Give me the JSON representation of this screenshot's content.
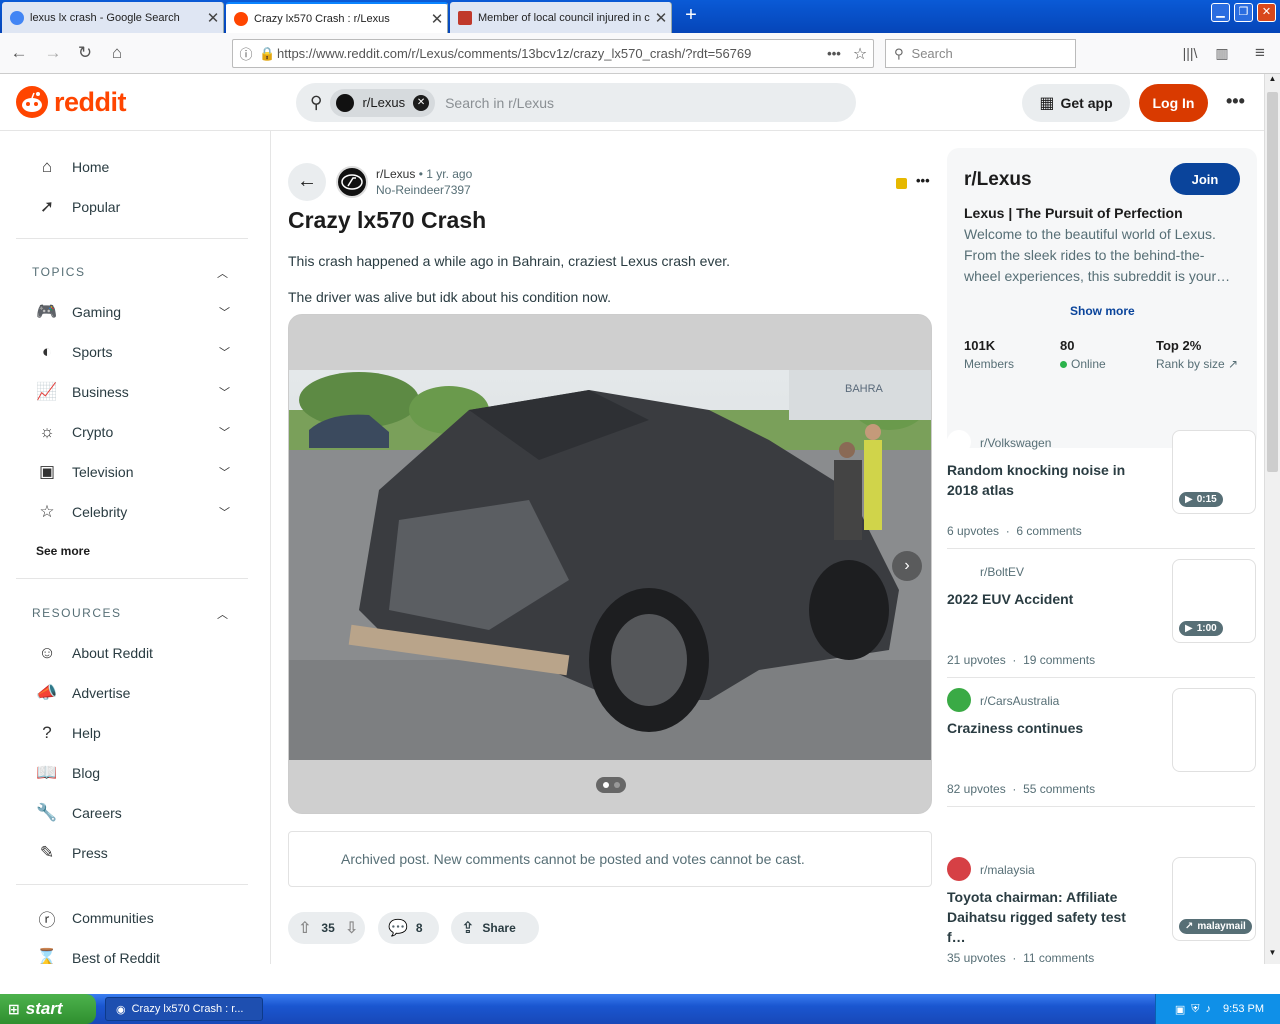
{
  "browser": {
    "tabs": [
      {
        "title": "lexus lx crash - Google Search",
        "favicon_color": "#4285f4"
      },
      {
        "title": "Crazy lx570 Crash : r/Lexus",
        "favicon_color": "#ff4500"
      },
      {
        "title": "Member of local council injured in c",
        "favicon_color": "#c0392b"
      }
    ],
    "url": "https://www.reddit.com/r/Lexus/comments/13bcv1z/crazy_lx570_crash/?rdt=56769",
    "search_placeholder": "Search"
  },
  "header": {
    "logo_text": "reddit",
    "search_chip": "r/Lexus",
    "search_placeholder": "Search in r/Lexus",
    "get_app": "Get app",
    "login": "Log In"
  },
  "sidebar": {
    "primary": [
      {
        "label": "Home",
        "icon": "home-icon"
      },
      {
        "label": "Popular",
        "icon": "popular-icon"
      }
    ],
    "topics_title": "TOPICS",
    "topics": [
      {
        "label": "Gaming",
        "icon": "gamepad-icon"
      },
      {
        "label": "Sports",
        "icon": "ball-icon"
      },
      {
        "label": "Business",
        "icon": "chart-icon"
      },
      {
        "label": "Crypto",
        "icon": "crypto-icon"
      },
      {
        "label": "Television",
        "icon": "tv-icon"
      },
      {
        "label": "Celebrity",
        "icon": "star-icon"
      }
    ],
    "see_more": "See more",
    "resources_title": "RESOURCES",
    "resources": [
      {
        "label": "About Reddit",
        "icon": "reddit-icon"
      },
      {
        "label": "Advertise",
        "icon": "megaphone-icon"
      },
      {
        "label": "Help",
        "icon": "help-icon"
      },
      {
        "label": "Blog",
        "icon": "book-icon"
      },
      {
        "label": "Careers",
        "icon": "wrench-icon"
      },
      {
        "label": "Press",
        "icon": "pen-icon"
      }
    ],
    "more": [
      {
        "label": "Communities",
        "icon": "communities-icon"
      },
      {
        "label": "Best of Reddit",
        "icon": "trophy-icon"
      }
    ]
  },
  "post": {
    "subreddit": "r/Lexus",
    "dot": "•",
    "age": "1 yr. ago",
    "author": "No-Reindeer7397",
    "title": "Crazy lx570 Crash",
    "body": [
      "This crash happened a while ago in Bahrain, craziest Lexus crash ever.",
      "The driver was alive but idk about his condition now."
    ],
    "sign_text": "BAHRA",
    "archived_notice": "Archived post. New comments cannot be posted and votes cannot be cast.",
    "upvotes": "35",
    "comments": "8",
    "share": "Share"
  },
  "community": {
    "name": "r/Lexus",
    "join": "Join",
    "headline": "Lexus | The Pursuit of Perfection",
    "description": "Welcome to the beautiful world of Lexus. From the sleek rides to the behind-the-wheel experiences, this subreddit is your…",
    "show_more": "Show more",
    "stats": [
      {
        "value": "101K",
        "label": "Members"
      },
      {
        "value": "80",
        "label": "Online"
      },
      {
        "value": "Top 2%",
        "label": "Rank by size"
      }
    ]
  },
  "related": [
    {
      "sub": "r/Volkswagen",
      "title": "Random knocking noise in 2018 atlas",
      "upvotes": "6 upvotes",
      "comments": "6 comments",
      "badge": "0:15",
      "avatar_color": "#ffffff"
    },
    {
      "sub": "r/BoltEV",
      "title": "2022 EUV Accident",
      "upvotes": "21 upvotes",
      "comments": "19 comments",
      "badge": "1:00",
      "avatar_color": "#ffffff"
    },
    {
      "sub": "r/CarsAustralia",
      "title": "Craziness continues",
      "upvotes": "82 upvotes",
      "comments": "55 comments",
      "badge": "",
      "avatar_color": "#3aaa45"
    },
    {
      "sub": "r/malaysia",
      "title": "Toyota chairman: Affiliate Daihatsu rigged safety test f…",
      "upvotes": "35 upvotes",
      "comments": "11 comments",
      "badge": "malaymail",
      "avatar_color": "#d64045"
    }
  ],
  "taskbar": {
    "start": "start",
    "item": "Crazy lx570 Crash : r...",
    "clock": "9:53 PM"
  }
}
